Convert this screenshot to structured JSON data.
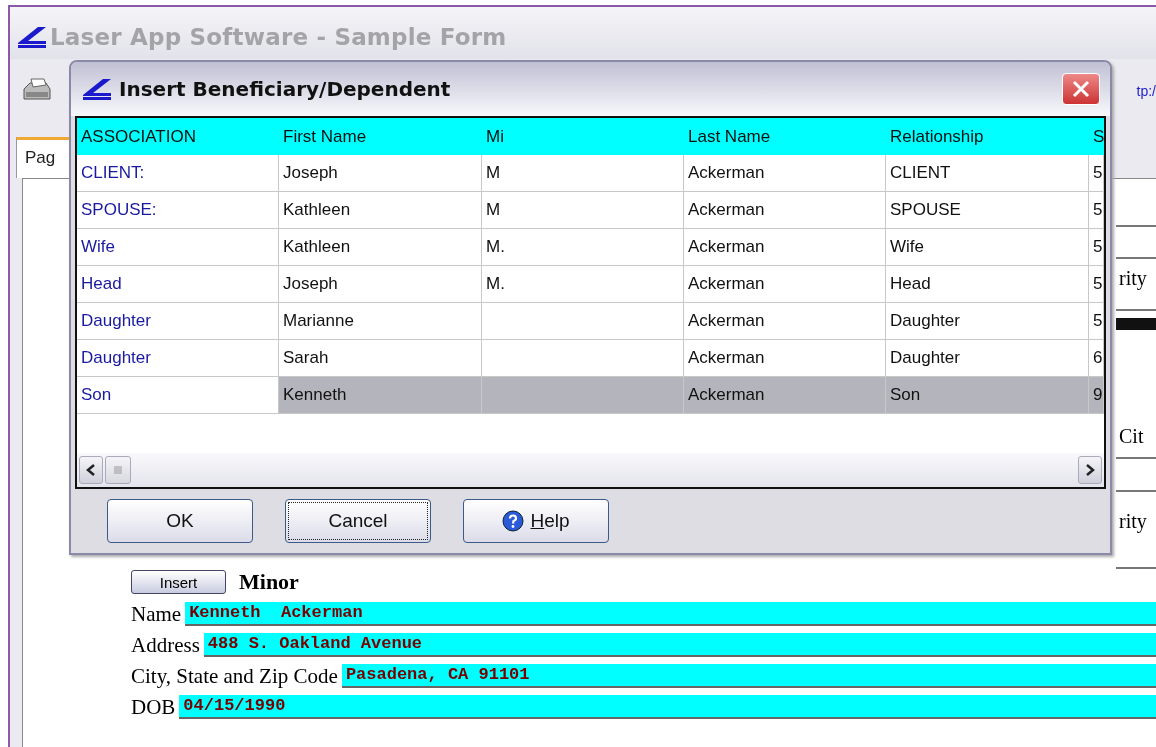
{
  "window": {
    "title": "Laser App Software - Sample Form"
  },
  "toolbar": {
    "link": "tp:/"
  },
  "tabs": [
    {
      "label": "Pag",
      "selected": true
    }
  ],
  "form": {
    "right_texts": [
      "rity",
      "Cit",
      "rity"
    ],
    "insert_button": "Insert",
    "section_title": "Minor",
    "fields": [
      {
        "label": "Name",
        "value": "Kenneth  Ackerman"
      },
      {
        "label": "Address",
        "value": "488 S. Oakland Avenue"
      },
      {
        "label": "City, State and Zip Code",
        "value": "Pasadena, CA 91101"
      },
      {
        "label": "DOB",
        "value": "04/15/1990"
      }
    ]
  },
  "dialog": {
    "title": "Insert Beneficiary/Dependent",
    "columns": [
      "ASSOCIATION",
      "First Name",
      "Mi",
      "Last Name",
      "Relationship",
      "S"
    ],
    "rows": [
      {
        "cells": [
          "CLIENT:",
          "Joseph",
          "M",
          "Ackerman",
          "CLIENT",
          "5"
        ],
        "selected": false
      },
      {
        "cells": [
          "SPOUSE:",
          "Kathleen",
          "M",
          "Ackerman",
          "SPOUSE",
          "5"
        ],
        "selected": false
      },
      {
        "cells": [
          "Wife",
          "Kathleen",
          "M.",
          "Ackerman",
          "Wife",
          "5"
        ],
        "selected": false
      },
      {
        "cells": [
          "Head",
          "Joseph",
          "M.",
          "Ackerman",
          "Head",
          "5"
        ],
        "selected": false
      },
      {
        "cells": [
          "Daughter",
          "Marianne",
          "",
          "Ackerman",
          "Daughter",
          "5"
        ],
        "selected": false
      },
      {
        "cells": [
          "Daughter",
          "Sarah",
          "",
          "Ackerman",
          "Daughter",
          "6"
        ],
        "selected": false
      },
      {
        "cells": [
          "Son",
          "Kenneth",
          "",
          "Ackerman",
          "Son",
          "9"
        ],
        "selected": true
      }
    ],
    "buttons": [
      {
        "label": "OK",
        "kind": "plain",
        "focused": false
      },
      {
        "label": "Cancel",
        "kind": "plain",
        "focused": true
      },
      {
        "label": "Help",
        "kind": "help",
        "focused": false
      }
    ]
  }
}
